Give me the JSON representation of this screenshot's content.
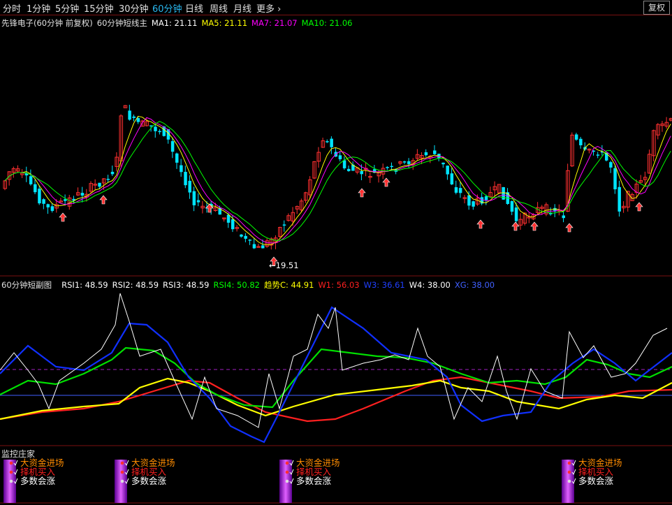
{
  "toolbar": {
    "tabs": [
      {
        "label": "分时",
        "active": false
      },
      {
        "label": "1分钟",
        "active": false
      },
      {
        "label": "5分钟",
        "active": false
      },
      {
        "label": "15分钟",
        "active": false
      },
      {
        "label": "30分钟",
        "active": false
      },
      {
        "label": "60分钟",
        "active": true
      },
      {
        "label": "日线",
        "active": false
      },
      {
        "label": "周线",
        "active": false
      },
      {
        "label": "月线",
        "active": false
      },
      {
        "label": "更多 ›",
        "active": false
      }
    ],
    "fuquan_button": "复权"
  },
  "main_panel": {
    "stock_title": "先锋电子(60分钟 前复权)",
    "indicator_name": "60分钟短线主",
    "ma1": {
      "label": "MA1: 21.11",
      "color": "#ffffff"
    },
    "ma5": {
      "label": "MA5: 21.11",
      "color": "#ffff00"
    },
    "ma7": {
      "label": "MA7: 21.07",
      "color": "#ff00ff"
    },
    "ma10": {
      "label": "MA10: 21.06",
      "color": "#00ff00"
    },
    "low_marker": "←19.51"
  },
  "sub_panel": {
    "title": "60分钟短副图",
    "items": [
      {
        "label": "RSI1: 48.59",
        "color": "#ffffff"
      },
      {
        "label": "RSI2: 48.59",
        "color": "#ffffff"
      },
      {
        "label": "RSI3: 48.59",
        "color": "#ffffff"
      },
      {
        "label": "RSI4: 50.82",
        "color": "#00ff00"
      },
      {
        "label": "趋势C: 44.91",
        "color": "#ffff00"
      },
      {
        "label": "W1: 56.03",
        "color": "#ff2020"
      },
      {
        "label": "W3: 36.61",
        "color": "#2040ff"
      },
      {
        "label": "W4: 38.00",
        "color": "#ffffff"
      },
      {
        "label": "XG: 38.00",
        "color": "#4060ff"
      }
    ]
  },
  "signal_panel": {
    "title": "监控庄家",
    "signal_labels": [
      "大资金进场",
      "择机买入",
      "多数会涨"
    ],
    "signal_colors": [
      "#ff8c00",
      "#ff2020",
      "#ffffff"
    ]
  },
  "colors": {
    "up": "#ff3030",
    "down": "#00e5ff",
    "border": "#7a1010",
    "background": "#000000"
  }
}
